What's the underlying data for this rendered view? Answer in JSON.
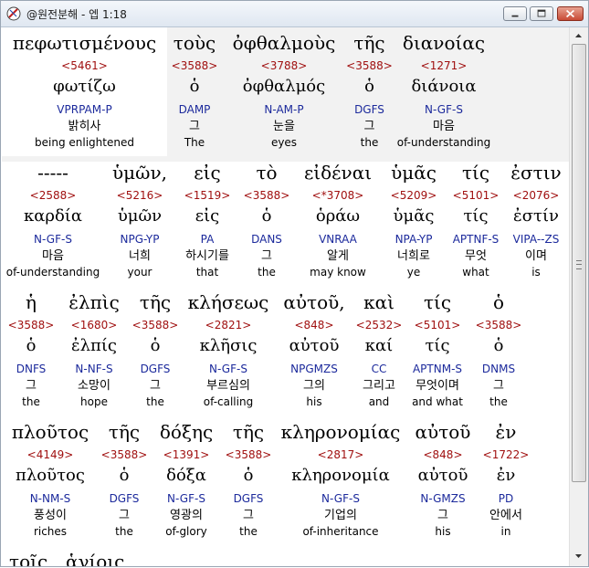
{
  "window": {
    "title": "@원전분해 - 엡 1:18",
    "buttons": {
      "minimize": "minimize",
      "maximize": "maximize",
      "close": "close"
    }
  },
  "rows": [
    {
      "words": [
        {
          "greek": "πεφωτισμένους",
          "strong": "<5461>",
          "lemma": "φωτίζω",
          "morph": "VPRPAM-P",
          "korean": "밝히사",
          "english": "being enlightened"
        },
        {
          "greek": "τοὺς",
          "strong": "<3588>",
          "lemma": "ὁ",
          "morph": "DAMP",
          "korean": "그",
          "english": "The"
        },
        {
          "greek": "ὀφθαλμοὺς",
          "strong": "<3788>",
          "lemma": "ὀφθαλμός",
          "morph": "N-AM-P",
          "korean": "눈을",
          "english": "eyes"
        },
        {
          "greek": "τῆς",
          "strong": "<3588>",
          "lemma": "ὁ",
          "morph": "DGFS",
          "korean": "그",
          "english": "the"
        },
        {
          "greek": "διανοίας",
          "strong": "<1271>",
          "lemma": "διάνοια",
          "morph": "N-GF-S",
          "korean": "마음",
          "english": "of-understanding"
        }
      ]
    },
    {
      "words": [
        {
          "greek": "-----",
          "strong": "<2588>",
          "lemma": "καρδία",
          "morph": "N-GF-S",
          "korean": "마음",
          "english": "of-understanding"
        },
        {
          "greek": "ὑμῶν,",
          "strong": "<5216>",
          "lemma": "ὑμῶν",
          "morph": "NPG-YP",
          "korean": "너희",
          "english": "your"
        },
        {
          "greek": "εἰς",
          "strong": "<1519>",
          "lemma": "εἰς",
          "morph": "PA",
          "korean": "하시기를",
          "english": "that"
        },
        {
          "greek": "τὸ",
          "strong": "<3588>",
          "lemma": "ὁ",
          "morph": "DANS",
          "korean": "그",
          "english": "the"
        },
        {
          "greek": "εἰδέναι",
          "strong": "<*3708>",
          "lemma": "ὁράω",
          "morph": "VNRAA",
          "korean": "알게",
          "english": "may know"
        },
        {
          "greek": "ὑμᾶς",
          "strong": "<5209>",
          "lemma": "ὑμᾶς",
          "morph": "NPA-YP",
          "korean": "너희로",
          "english": "ye"
        },
        {
          "greek": "τίς",
          "strong": "<5101>",
          "lemma": "τίς",
          "morph": "APTNF-S",
          "korean": "무엇",
          "english": "what"
        },
        {
          "greek": "ἐστιν",
          "strong": "<2076>",
          "lemma": "ἐστίν",
          "morph": "VIPA--ZS",
          "korean": "이며",
          "english": "is"
        }
      ]
    },
    {
      "words": [
        {
          "greek": "ἡ",
          "strong": "<3588>",
          "lemma": "ὁ",
          "morph": "DNFS",
          "korean": "그",
          "english": "the"
        },
        {
          "greek": "ἐλπὶς",
          "strong": "<1680>",
          "lemma": "ἐλπίς",
          "morph": "N-NF-S",
          "korean": "소망이",
          "english": "hope"
        },
        {
          "greek": "τῆς",
          "strong": "<3588>",
          "lemma": "ὁ",
          "morph": "DGFS",
          "korean": "그",
          "english": "the"
        },
        {
          "greek": "κλήσεως",
          "strong": "<2821>",
          "lemma": "κλῆσις",
          "morph": "N-GF-S",
          "korean": "부르심의",
          "english": "of-calling"
        },
        {
          "greek": "αὐτοῦ,",
          "strong": "<848>",
          "lemma": "αὐτοῦ",
          "morph": "NPGMZS",
          "korean": "그의",
          "english": "his"
        },
        {
          "greek": "καὶ",
          "strong": "<2532>",
          "lemma": "καί",
          "morph": "CC",
          "korean": "그리고",
          "english": "and"
        },
        {
          "greek": "τίς",
          "strong": "<5101>",
          "lemma": "τίς",
          "morph": "APTNM-S",
          "korean": "무엇이며",
          "english": "and what"
        },
        {
          "greek": "ὁ",
          "strong": "<3588>",
          "lemma": "ὁ",
          "morph": "DNMS",
          "korean": "그",
          "english": "the"
        }
      ]
    },
    {
      "words": [
        {
          "greek": "πλοῦτος",
          "strong": "<4149>",
          "lemma": "πλοῦτος",
          "morph": "N-NM-S",
          "korean": "풍성이",
          "english": "riches"
        },
        {
          "greek": "τῆς",
          "strong": "<3588>",
          "lemma": "ὁ",
          "morph": "DGFS",
          "korean": "그",
          "english": "the"
        },
        {
          "greek": "δόξης",
          "strong": "<1391>",
          "lemma": "δόξα",
          "morph": "N-GF-S",
          "korean": "영광의",
          "english": "of-glory"
        },
        {
          "greek": "τῆς",
          "strong": "<3588>",
          "lemma": "ὁ",
          "morph": "DGFS",
          "korean": "그",
          "english": "the"
        },
        {
          "greek": "κληρονομίας",
          "strong": "<2817>",
          "lemma": "κληρονομία",
          "morph": "N-GF-S",
          "korean": "기업의",
          "english": "of-inheritance"
        },
        {
          "greek": "αὐτοῦ",
          "strong": "<848>",
          "lemma": "αὐτοῦ",
          "morph": "N-GMZS",
          "korean": "그",
          "english": "his"
        },
        {
          "greek": "ἐν",
          "strong": "<1722>",
          "lemma": "ἐν",
          "morph": "PD",
          "korean": "안에서",
          "english": "in"
        }
      ]
    }
  ],
  "partial_row": {
    "words": [
      {
        "greek": "τοῖς"
      },
      {
        "greek": "ἁγίοις"
      }
    ]
  }
}
